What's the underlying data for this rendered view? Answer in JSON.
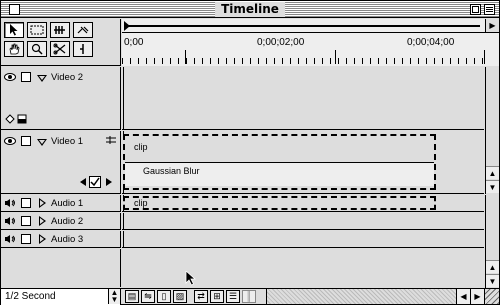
{
  "window": {
    "title": "Timeline"
  },
  "tools": {
    "row1": [
      "selection-arrow",
      "range-select",
      "track-select",
      "link-tool"
    ],
    "row2": [
      "hand",
      "zoom",
      "razor",
      "in-out-point"
    ]
  },
  "ruler": {
    "timecodes": [
      "0;00",
      "0;00;02;00",
      "0;00;04;00"
    ]
  },
  "tracks": {
    "video2": {
      "name": "Video 2"
    },
    "video1": {
      "name": "Video 1",
      "clip": "clip",
      "effect": "Gaussian Blur"
    },
    "audio1": {
      "name": "Audio 1",
      "clip": "clip"
    },
    "audio2": {
      "name": "Audio 2"
    },
    "audio3": {
      "name": "Audio 3"
    }
  },
  "bottom": {
    "duration": "1/2 Second"
  },
  "colors": {
    "background": "#dddddd",
    "window_border": "#000000",
    "panel": "#eeeeee"
  }
}
